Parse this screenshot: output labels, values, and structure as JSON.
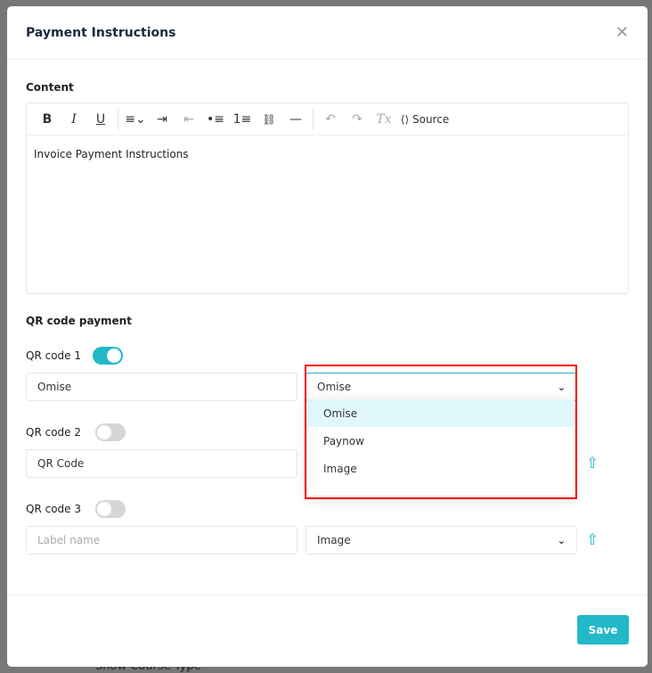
{
  "background": {
    "text": "Show Course Type"
  },
  "modal": {
    "title": "Payment Instructions",
    "close_icon": "close-icon"
  },
  "content": {
    "label": "Content",
    "body": "Invoice Payment Instructions",
    "toolbar": {
      "bold": "B",
      "italic": "I",
      "underline": "U",
      "align": "≡⌄",
      "indent": "⇥",
      "outdent": "⇤",
      "bullets": "•≡",
      "numbers": "1≡",
      "link": "🔗",
      "hr": "—",
      "undo": "↶",
      "redo": "↷",
      "clear": "Tx",
      "source": "Source"
    }
  },
  "qr": {
    "section_label": "QR code payment",
    "items": [
      {
        "label": "QR code 1",
        "enabled": true,
        "name": "Omise",
        "type": "Omise"
      },
      {
        "label": "QR code 2",
        "enabled": false,
        "name": "QR Code",
        "type": ""
      },
      {
        "label": "QR code 3",
        "enabled": false,
        "name": "",
        "placeholder": "Label name",
        "type": "Image"
      }
    ],
    "dropdown_options": [
      "Omise",
      "Paynow",
      "Image"
    ],
    "accent": "#22b8c8"
  },
  "footer": {
    "save_label": "Save"
  }
}
